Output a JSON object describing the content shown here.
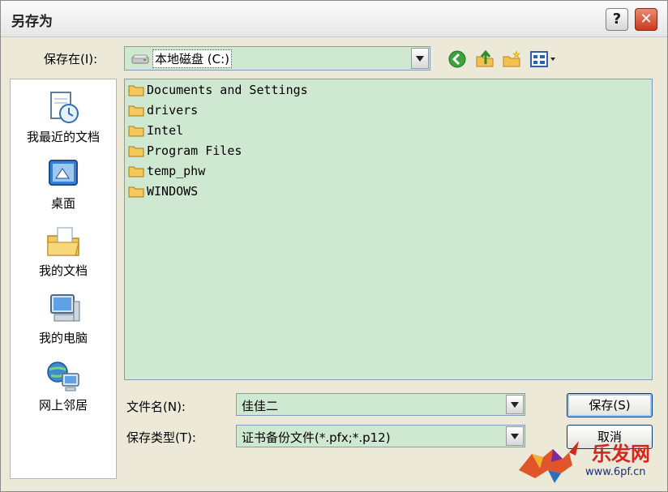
{
  "window": {
    "title": "另存为",
    "help_label": "?",
    "close_label": "✕"
  },
  "save_in": {
    "label": "保存在(I):",
    "value": "本地磁盘 (C:)"
  },
  "toolbar": {
    "back_icon": "back-icon",
    "up_icon": "up-folder-icon",
    "new_folder_icon": "new-folder-icon",
    "views_icon": "views-menu-icon"
  },
  "places": [
    {
      "label": "我最近的文档",
      "icon": "recent-documents-icon"
    },
    {
      "label": "桌面",
      "icon": "desktop-icon"
    },
    {
      "label": "我的文档",
      "icon": "my-documents-icon"
    },
    {
      "label": "我的电脑",
      "icon": "my-computer-icon"
    },
    {
      "label": "网上邻居",
      "icon": "network-places-icon"
    }
  ],
  "files": [
    {
      "name": "Documents and Settings"
    },
    {
      "name": "drivers"
    },
    {
      "name": "Intel"
    },
    {
      "name": "Program Files"
    },
    {
      "name": "temp_phw"
    },
    {
      "name": "WINDOWS"
    }
  ],
  "filename": {
    "label": "文件名(N):",
    "value": "佳佳二"
  },
  "filetype": {
    "label": "保存类型(T):",
    "value": "证书备份文件(*.pfx;*.p12)"
  },
  "buttons": {
    "save": "保存(S)",
    "cancel": "取消"
  },
  "watermark": {
    "text": "乐发网",
    "url": "www.6pf.cn"
  },
  "colors": {
    "field_bg": "#cfe8d1",
    "dialog_bg": "#ece9d8",
    "close_red": "#c8391b"
  }
}
